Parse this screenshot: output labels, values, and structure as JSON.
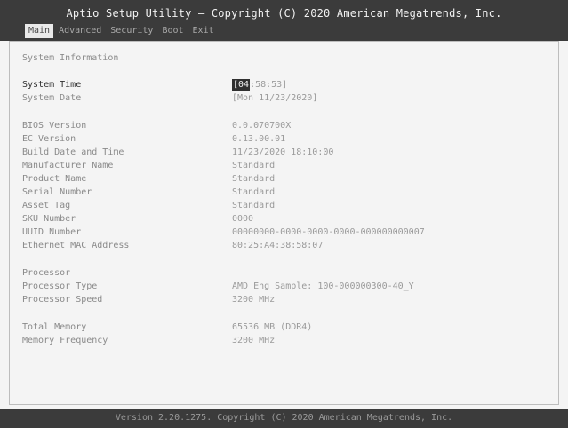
{
  "header": {
    "title": "Aptio Setup Utility – Copyright (C) 2020 American Megatrends, Inc.",
    "tabs": [
      "Main",
      "Advanced",
      "Security",
      "Boot",
      "Exit"
    ],
    "active_tab": "Main"
  },
  "main": {
    "section_title": "System Information",
    "system_time": {
      "label": "System Time",
      "value_prefix": "[04",
      "value_rest": ":58:53]"
    },
    "system_date": {
      "label": "System Date",
      "value": "[Mon 11/23/2020]"
    },
    "bios": [
      {
        "label": "BIOS Version",
        "value": "0.0.070700X"
      },
      {
        "label": "EC Version",
        "value": "0.13.00.01"
      },
      {
        "label": "Build Date and Time",
        "value": "11/23/2020 18:10:00"
      },
      {
        "label": "Manufacturer Name",
        "value": "Standard"
      },
      {
        "label": "Product Name",
        "value": "Standard"
      },
      {
        "label": "Serial Number",
        "value": "Standard"
      },
      {
        "label": "Asset Tag",
        "value": "Standard"
      },
      {
        "label": "SKU Number",
        "value": "0000"
      },
      {
        "label": "UUID Number",
        "value": "00000000-0000-0000-0000-000000000007"
      },
      {
        "label": "Ethernet MAC Address",
        "value": "80:25:A4:38:58:07"
      }
    ],
    "processor_section": "Processor",
    "processor": [
      {
        "label": "Processor Type",
        "value": "AMD Eng Sample: 100-000000300-40_Y"
      },
      {
        "label": "Processor Speed",
        "value": "3200 MHz"
      }
    ],
    "memory": [
      {
        "label": "Total Memory",
        "value": "65536 MB (DDR4)"
      },
      {
        "label": "Memory Frequency",
        "value": "3200 MHz"
      }
    ]
  },
  "footer": {
    "text": "Version 2.20.1275. Copyright (C) 2020 American Megatrends, Inc."
  }
}
